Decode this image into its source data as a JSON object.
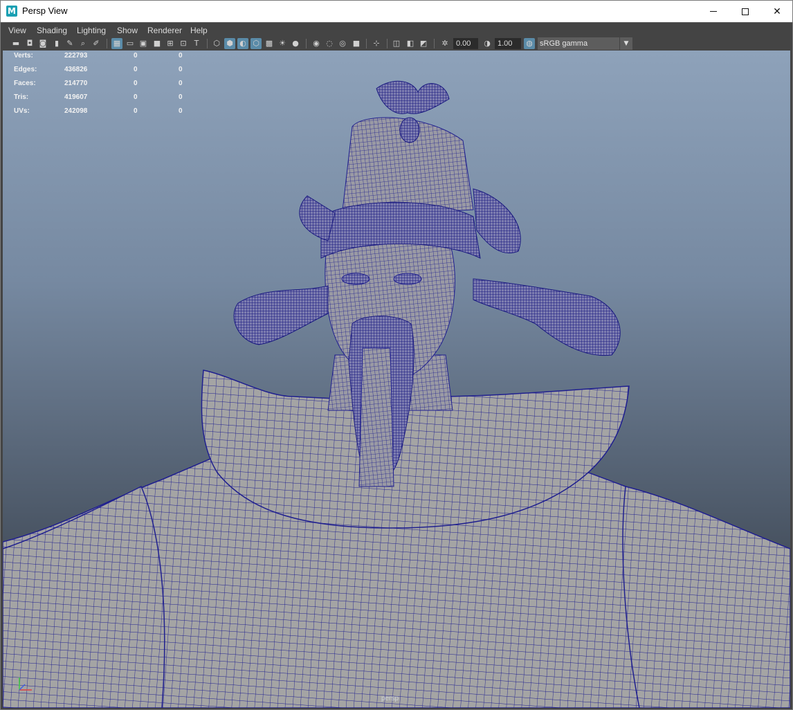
{
  "window": {
    "title": "Persp View",
    "app_icon": "M"
  },
  "menu": [
    "View",
    "Shading",
    "Lighting",
    "Show",
    "Renderer",
    "Help"
  ],
  "toolbar": {
    "exposure": "0.00",
    "gamma": "1.00",
    "color_management": "sRGB gamma"
  },
  "hud": {
    "rows": [
      {
        "label": "Verts:",
        "total": "222793",
        "sel": "0",
        "comp": "0"
      },
      {
        "label": "Edges:",
        "total": "436826",
        "sel": "0",
        "comp": "0"
      },
      {
        "label": "Faces:",
        "total": "214770",
        "sel": "0",
        "comp": "0"
      },
      {
        "label": "Tris:",
        "total": "419607",
        "sel": "0",
        "comp": "0"
      },
      {
        "label": "UVs:",
        "total": "242098",
        "sel": "0",
        "comp": "0"
      }
    ]
  },
  "viewport": {
    "camera_label": "persp",
    "wire_color": "#1f1f8f",
    "mesh_color": "#a4a4a4"
  }
}
